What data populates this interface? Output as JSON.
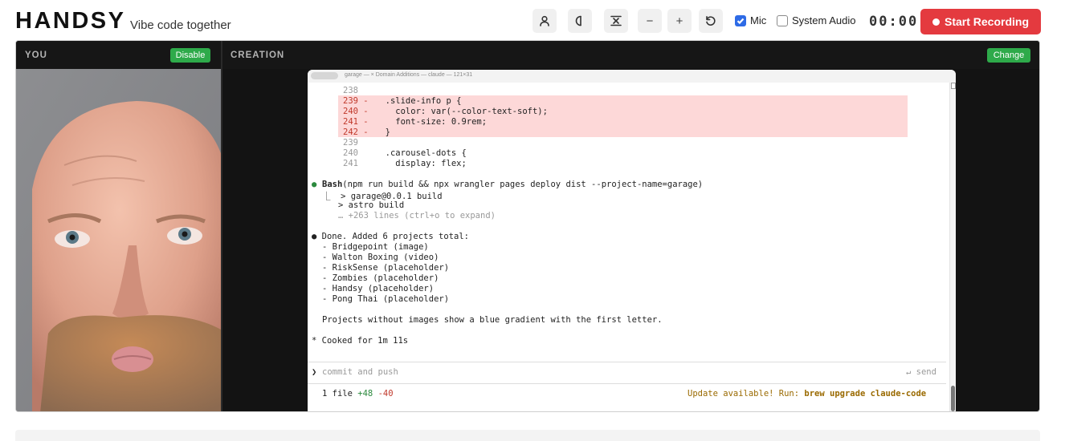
{
  "app": {
    "logo": "HANDSY",
    "tagline": "Vibe code together"
  },
  "toolbar": {
    "buttons": [
      {
        "name": "user-icon"
      },
      {
        "name": "contrast-icon"
      },
      {
        "name": "fit-icon"
      },
      {
        "name": "zoom-out-icon",
        "glyph": "−"
      },
      {
        "name": "zoom-in-icon",
        "glyph": "+"
      },
      {
        "name": "reset-icon"
      }
    ],
    "mic_label": "Mic",
    "mic_checked": true,
    "system_audio_label": "System Audio",
    "system_audio_checked": false,
    "timer": "00:00",
    "record_label": "Start Recording"
  },
  "panels": {
    "you": {
      "title": "YOU",
      "button": "Disable"
    },
    "creation": {
      "title": "CREATION",
      "button": "Change"
    }
  },
  "terminal": {
    "title": "garage — × Domain Additions — claude — 121×31",
    "lines": [
      {
        "num": "238",
        "text": ""
      },
      {
        "num": "239 -",
        "text": "  .slide-info p {"
      },
      {
        "num": "240 -",
        "text": "    color: var(--color-text-soft);"
      },
      {
        "num": "241 -",
        "text": "    font-size: 0.9rem;"
      },
      {
        "num": "242 -",
        "text": "  }"
      },
      {
        "num": "239",
        "text": ""
      },
      {
        "num": "240",
        "text": "  .carousel-dots {"
      },
      {
        "num": "241",
        "text": "    display: flex;"
      }
    ],
    "bash_bullet": "●",
    "bash_cmd": "Bash",
    "bash_args": "(npm run build && npx wrangler pages deploy dist --project-name=garage)",
    "bash_out1": "⎿  > garage@0.0.1 build",
    "bash_out2": "> astro build",
    "bash_out3": "… +263 lines (ctrl+o to expand)",
    "done_line": "● Done. Added 6 projects total:",
    "projects": [
      "- Bridgepoint (image)",
      "- Walton Boxing (video)",
      "- RiskSense (placeholder)",
      "- Zombies (placeholder)",
      "- Handsy (placeholder)",
      "- Pong Thai (placeholder)"
    ],
    "note": "Projects without images show a blue gradient with the first letter.",
    "cooked": "* Cooked for 1m 11s",
    "prompt_symbol": "❯",
    "prompt_value": "commit and push",
    "send_label": "↵ send",
    "status_files": "1 file",
    "status_add": "+48",
    "status_del": "-40",
    "update_text": "Update available! Run:",
    "update_cmd": "brew upgrade claude-code"
  },
  "colors": {
    "record": "#e43a3f",
    "green_button": "#2eaa4a",
    "diff_removed_bg": "#fdd8d8",
    "stage_bg": "#131313"
  }
}
